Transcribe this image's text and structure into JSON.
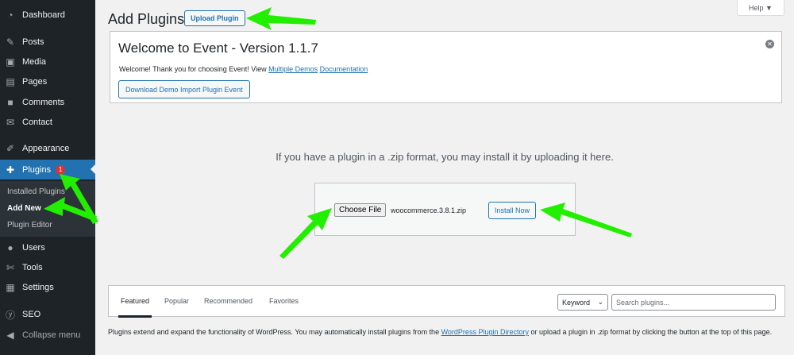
{
  "sidebar": {
    "items": [
      {
        "label": "Dashboard",
        "icon": "dashboard-icon"
      },
      {
        "label": "Posts",
        "icon": "pin-icon"
      },
      {
        "label": "Media",
        "icon": "media-icon"
      },
      {
        "label": "Pages",
        "icon": "pages-icon"
      },
      {
        "label": "Comments",
        "icon": "comment-icon"
      },
      {
        "label": "Contact",
        "icon": "mail-icon"
      },
      {
        "label": "Appearance",
        "icon": "brush-icon"
      },
      {
        "label": "Plugins",
        "icon": "plugin-icon",
        "badge": "1"
      },
      {
        "label": "Users",
        "icon": "user-icon"
      },
      {
        "label": "Tools",
        "icon": "wrench-icon"
      },
      {
        "label": "Settings",
        "icon": "settings-icon"
      },
      {
        "label": "SEO",
        "icon": "seo-icon"
      },
      {
        "label": "Collapse menu",
        "icon": "collapse-icon"
      }
    ],
    "submenu": [
      "Installed Plugins",
      "Add New",
      "Plugin Editor"
    ]
  },
  "header": {
    "title": "Add Plugins",
    "upload_label": "Upload Plugin",
    "help_label": "Help ▼"
  },
  "notice": {
    "title": "Welcome to Event - Version 1.1.7",
    "text": "Welcome! Thank you for choosing Event! View",
    "link1": "Multiple Demos",
    "link2": "Documentation",
    "button": "Download Demo Import Plugin Event"
  },
  "upload": {
    "description": "If you have a plugin in a .zip format, you may install it by uploading it here.",
    "choose_label": "Choose File",
    "file_name": "woocommerce.3.8.1.zip",
    "install_label": "Install Now"
  },
  "filter": {
    "tabs": [
      "Featured",
      "Popular",
      "Recommended",
      "Favorites"
    ],
    "select_value": "Keyword",
    "search_placeholder": "Search plugins..."
  },
  "footer": {
    "text_before": "Plugins extend and expand the functionality of WordPress. You may automatically install plugins from the",
    "link": "WordPress Plugin Directory",
    "text_after": "or upload a plugin in .zip format by clicking the button at the top of this page."
  },
  "colors": {
    "sidebar_bg": "#1d2327",
    "accent": "#2271b1",
    "badge": "#d63638",
    "arrow": "#22ee00"
  }
}
